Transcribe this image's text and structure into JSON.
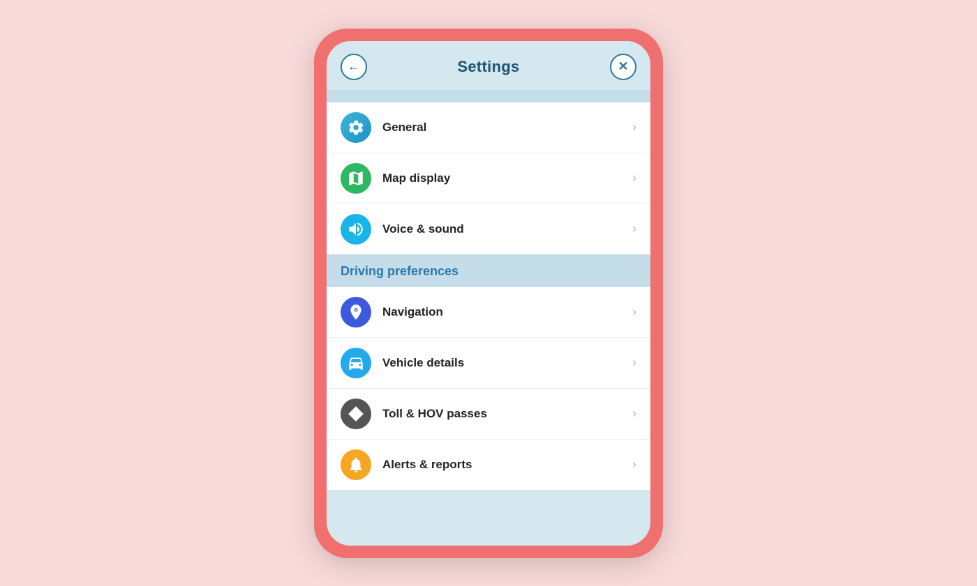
{
  "header": {
    "title": "Settings",
    "back_label": "←",
    "close_label": "✕"
  },
  "sections": [
    {
      "id": "general-section",
      "items": [
        {
          "id": "general",
          "label": "General",
          "icon": "gear-icon",
          "icon_class": "icon-general"
        },
        {
          "id": "map-display",
          "label": "Map display",
          "icon": "map-icon",
          "icon_class": "icon-map"
        },
        {
          "id": "voice-sound",
          "label": "Voice & sound",
          "icon": "speaker-icon",
          "icon_class": "icon-voice"
        }
      ]
    },
    {
      "id": "driving-preferences",
      "header": "Driving preferences",
      "items": [
        {
          "id": "navigation",
          "label": "Navigation",
          "icon": "navigation-icon",
          "icon_class": "icon-navigation"
        },
        {
          "id": "vehicle-details",
          "label": "Vehicle details",
          "icon": "car-icon",
          "icon_class": "icon-vehicle"
        },
        {
          "id": "toll-hov",
          "label": "Toll & HOV passes",
          "icon": "diamond-icon",
          "icon_class": "icon-toll"
        },
        {
          "id": "alerts-reports",
          "label": "Alerts & reports",
          "icon": "alert-icon",
          "icon_class": "icon-alerts"
        }
      ]
    }
  ],
  "colors": {
    "background": "#f9dada",
    "phone_shell": "#f07070",
    "screen_bg": "#d6e8ef",
    "section_bg": "#c5dde8",
    "header_text": "#1a5570",
    "section_header_text": "#2a7ab0"
  }
}
